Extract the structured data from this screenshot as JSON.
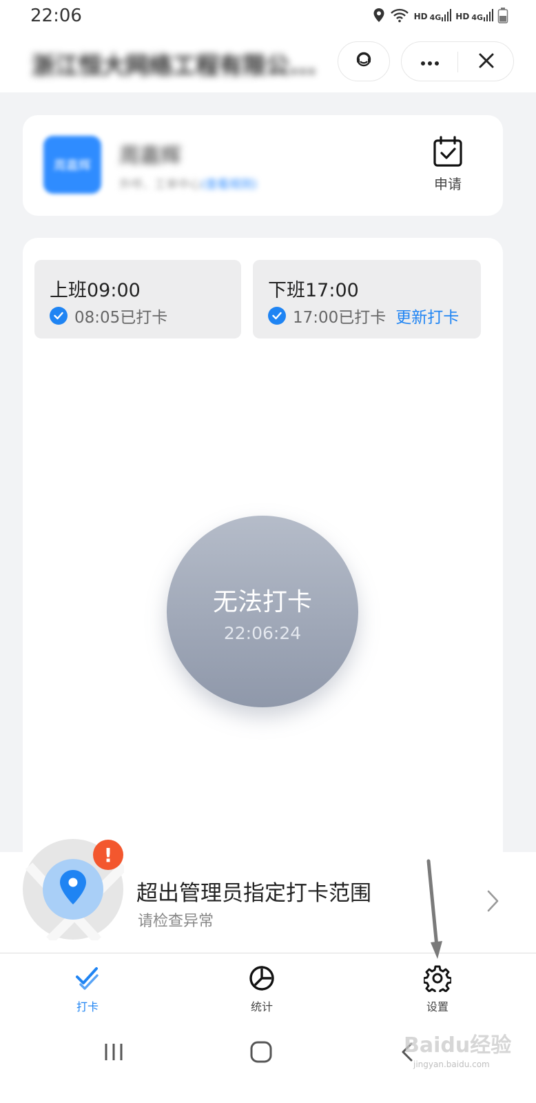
{
  "status_bar": {
    "time": "22:06",
    "network_1": {
      "label": "HD",
      "type": "4G"
    },
    "network_2": {
      "label": "HD",
      "type": "4G"
    },
    "icons": [
      "location-icon",
      "wifi-icon",
      "signal-icon",
      "battery-icon"
    ]
  },
  "title_bar": {
    "title": "浙江恒大网络工程有限公...",
    "buttons": [
      "customer-service-icon",
      "more-icon",
      "close-icon"
    ]
  },
  "user_card": {
    "avatar_text": "周嘉辉",
    "name": "周嘉辉",
    "subtitle": "外呼、工单中心",
    "subtitle_link": "(查看规则)",
    "apply_label": "申请"
  },
  "shifts": [
    {
      "title": "上班09:00",
      "status": "08:05已打卡"
    },
    {
      "title": "下班17:00",
      "status": "17:00已打卡",
      "action": "更新打卡"
    }
  ],
  "punch": {
    "label": "无法打卡",
    "time": "22:06:24"
  },
  "range_warning": {
    "title": "超出管理员指定打卡范围",
    "subtitle": "请检查异常",
    "badge": "!"
  },
  "tabs": [
    {
      "label": "打卡",
      "icon": "punch-check-icon",
      "active": true
    },
    {
      "label": "统计",
      "icon": "stats-pie-icon",
      "active": false
    },
    {
      "label": "设置",
      "icon": "gear-icon",
      "active": false
    }
  ],
  "watermark": {
    "brand": "Baidu经验",
    "url": "jingyan.baidu.com"
  },
  "colors": {
    "accent": "#1f84f3",
    "warning": "#f3572e",
    "punch_disabled": "#9aa2b3",
    "background": "#f2f3f5"
  }
}
